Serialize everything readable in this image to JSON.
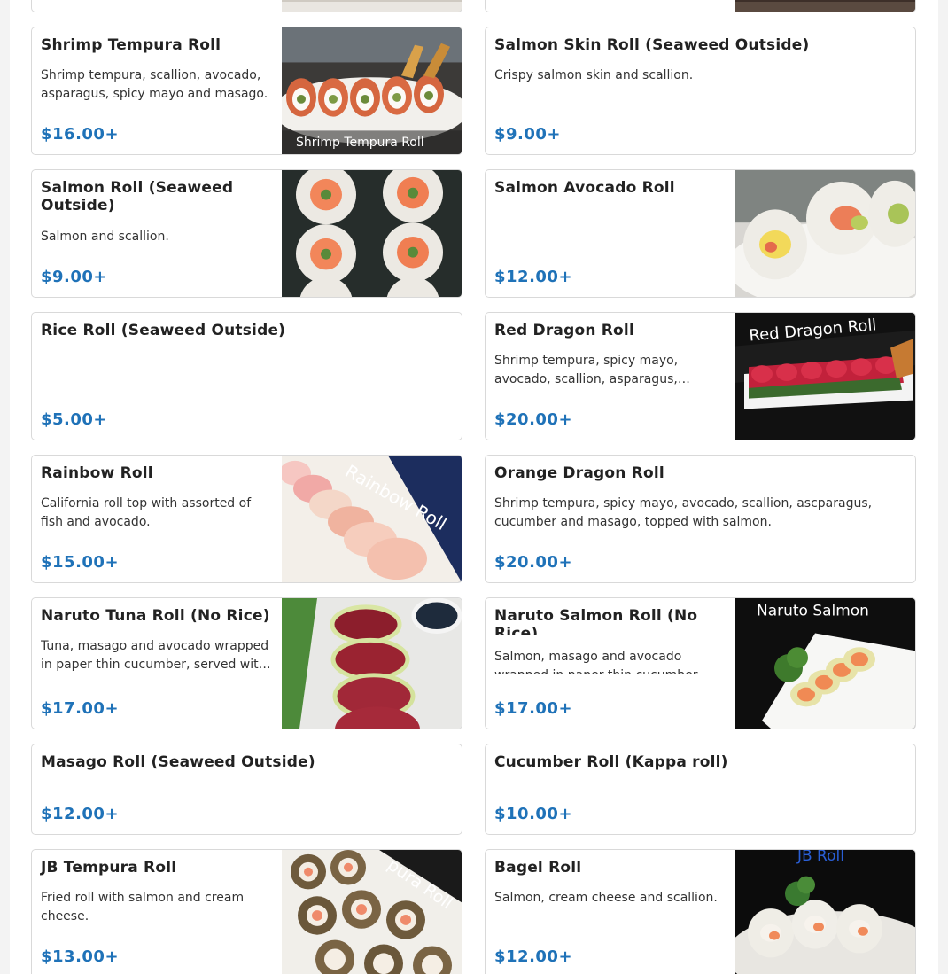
{
  "menu": {
    "items": [
      {
        "title": "Shrimp Tempura Roll",
        "description": "Shrimp tempura, scallion, avocado, asparagus, spicy mayo and masago.",
        "price": "$16.00+",
        "image_caption": "Shrimp Tempura Roll"
      },
      {
        "title": "Salmon Skin Roll (Seaweed Outside)",
        "description": "Crispy salmon skin and scallion.",
        "price": "$9.00+"
      },
      {
        "title": "Salmon Roll (Seaweed Outside)",
        "description": "Salmon and scallion.",
        "price": "$9.00+"
      },
      {
        "title": "Salmon Avocado Roll",
        "description": "",
        "price": "$12.00+"
      },
      {
        "title": "Rice Roll (Seaweed Outside)",
        "description": "",
        "price": "$5.00+"
      },
      {
        "title": "Red Dragon Roll",
        "description": "Shrimp tempura, spicy mayo, avocado, scallion, asparagus,…",
        "price": "$20.00+",
        "image_caption": "Red Dragon Roll"
      },
      {
        "title": "Rainbow Roll",
        "description": "California roll top with assorted of fish and avocado.",
        "price": "$15.00+",
        "image_caption": "Rainbow Roll"
      },
      {
        "title": "Orange Dragon Roll",
        "description": "Shrimp tempura, spicy mayo, avocado, scallion, ascparagus, cucumber and masago, topped with salmon.",
        "price": "$20.00+"
      },
      {
        "title": "Naruto Tuna Roll (No Rice)",
        "description": "Tuna, masago and avocado wrapped in paper thin cucumber, served wit…",
        "price": "$17.00+"
      },
      {
        "title": "Naruto Salmon Roll (No Rice)",
        "description": "Salmon, masago and avocado wrapped in paper thin cucumber",
        "price": "$17.00+",
        "image_caption": "Naruto Salmon"
      },
      {
        "title": "Masago Roll (Seaweed Outside)",
        "description": "",
        "price": "$12.00+"
      },
      {
        "title": "Cucumber Roll (Kappa roll)",
        "description": "",
        "price": "$10.00+"
      },
      {
        "title": "JB Tempura Roll",
        "description": "Fried roll with salmon and cream cheese.",
        "price": "$13.00+",
        "image_caption": "pura Roll"
      },
      {
        "title": "Bagel Roll",
        "description": "Salmon, cream cheese and scallion.",
        "price": "$12.00+",
        "image_caption": "JB Roll"
      }
    ]
  },
  "colors": {
    "price": "#1f72b8",
    "border": "#d9d9d9",
    "title": "#222222"
  }
}
